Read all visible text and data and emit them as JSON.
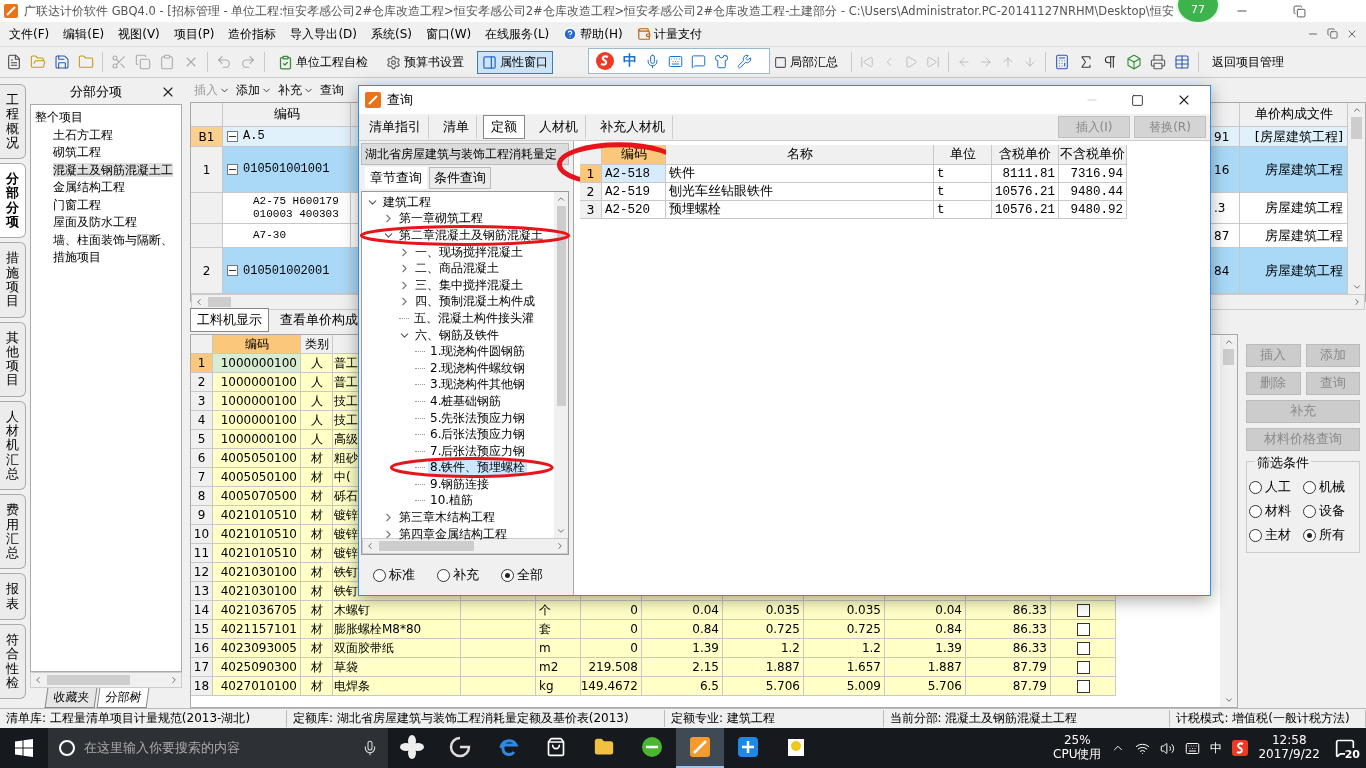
{
  "window": {
    "title": "广联达计价软件 GBQ4.0 - [招标管理 - 单位工程:恒安孝感公司2#仓库改造工程>恒安孝感公司2#仓库改造工程>恒安孝感公司2#仓库改造工程-土建部分 - C:\\Users\\Administrator.PC-20141127NRHM\\Desktop\\恒安",
    "badge": "77"
  },
  "menu": [
    {
      "label": "文件(F)",
      "kind": "text"
    },
    {
      "label": "编辑(E)",
      "kind": "text"
    },
    {
      "label": "视图(V)",
      "kind": "text"
    },
    {
      "label": "项目(P)",
      "kind": "text"
    },
    {
      "label": "造价指标",
      "kind": "text"
    },
    {
      "label": "导入导出(D)",
      "kind": "text"
    },
    {
      "label": "系统(S)",
      "kind": "text"
    },
    {
      "label": "窗口(W)",
      "kind": "text"
    },
    {
      "label": "在线服务(L)",
      "kind": "text"
    },
    {
      "label": "帮助(H)",
      "kind": "help"
    },
    {
      "label": "计量支付",
      "kind": "pay"
    }
  ],
  "toolbar": {
    "check": {
      "label": "单位工程自检"
    },
    "settings": {
      "label": "预算书设置"
    },
    "properties": {
      "label": "属性窗口",
      "selected": true
    },
    "partial_summary": {
      "label": "局部汇总"
    },
    "back": {
      "label": "返回项目管理"
    }
  },
  "ime": {
    "mode": "中"
  },
  "side_tabs": [
    {
      "label": "工程概况",
      "selected": false
    },
    {
      "label": "分部分项",
      "selected": true
    },
    {
      "label": "措施项目",
      "selected": false
    },
    {
      "label": "其他项目",
      "selected": false
    },
    {
      "label": "人材机汇总",
      "selected": false
    },
    {
      "label": "费用汇总",
      "selected": false
    },
    {
      "label": "报表",
      "selected": false
    },
    {
      "label": "符合性检",
      "selected": false
    }
  ],
  "left_panel": {
    "title": "分部分项",
    "tree": {
      "label": "整个项目",
      "selected": false,
      "children": [
        {
          "label": "土石方工程",
          "selected": false
        },
        {
          "label": "砌筑工程",
          "selected": false
        },
        {
          "label": "混凝土及钢筋混凝土工",
          "selected": true
        },
        {
          "label": "金属结构工程",
          "selected": false
        },
        {
          "label": "门窗工程",
          "selected": false
        },
        {
          "label": "屋面及防水工程",
          "selected": false
        },
        {
          "label": "墙、柱面装饰与隔断、",
          "selected": false
        },
        {
          "label": "措施项目",
          "selected": false
        }
      ]
    },
    "tabs": [
      {
        "label": "收藏夹",
        "selected": false
      },
      {
        "label": "分部树",
        "selected": true
      }
    ]
  },
  "grid_toolbar": [
    {
      "label": "插入",
      "disabled": true,
      "dropdown": true
    },
    {
      "label": "添加",
      "disabled": false,
      "dropdown": true
    },
    {
      "label": "补充",
      "disabled": false,
      "dropdown": true
    },
    {
      "label": "查询",
      "disabled": false,
      "dropdown": false
    }
  ],
  "top_grid": {
    "columns": [
      "编码",
      "单价构成文件"
    ],
    "rows": [
      {
        "kind": "division",
        "num": "B1",
        "code": "A.5",
        "expanded": true,
        "column_3": "91",
        "file": "[房屋建筑工程]"
      },
      {
        "kind": "bill",
        "num": "1",
        "code": "010501001001",
        "expanded": true,
        "column_3": "16",
        "file": "房屋建筑工程"
      },
      {
        "kind": "quota",
        "code": "A2-75 H600179 010003 400303",
        "column_3": ".3",
        "file": "房屋建筑工程"
      },
      {
        "kind": "quota",
        "code": "A7-30",
        "column_3": "87",
        "file": "房屋建筑工程"
      },
      {
        "kind": "bill",
        "num": "2",
        "code": "010501002001",
        "expanded": true,
        "column_3": "84",
        "file": "房屋建筑工程"
      }
    ]
  },
  "bottom_tabs": [
    {
      "label": "工料机显示",
      "selected": true
    },
    {
      "label": "查看单价构成",
      "selected": false
    }
  ],
  "bottom_grid": {
    "columns": [
      "编码",
      "类别"
    ],
    "rows": [
      {
        "num": "1",
        "code": "1000000100",
        "type": "人",
        "name": "普工",
        "selected": true
      },
      {
        "num": "2",
        "code": "1000000100",
        "type": "人",
        "name": "普工",
        "selected": false
      },
      {
        "num": "3",
        "code": "1000000100",
        "type": "人",
        "name": "技工",
        "selected": false
      },
      {
        "num": "4",
        "code": "1000000100",
        "type": "人",
        "name": "技工",
        "selected": false
      },
      {
        "num": "5",
        "code": "1000000100",
        "type": "人",
        "name": "高级",
        "selected": false
      },
      {
        "num": "6",
        "code": "4005050100",
        "type": "材",
        "name": "粗砂",
        "selected": false
      },
      {
        "num": "7",
        "code": "4005050100",
        "type": "材",
        "name": "中(",
        "selected": false
      },
      {
        "num": "8",
        "code": "4005070500",
        "type": "材",
        "name": "砾石",
        "selected": false
      },
      {
        "num": "9",
        "code": "4021010510",
        "type": "材",
        "name": "镀锌",
        "selected": false
      },
      {
        "num": "10",
        "code": "4021010510",
        "type": "材",
        "name": "镀锌",
        "selected": false
      },
      {
        "num": "11",
        "code": "4021010510",
        "type": "材",
        "name": "镀锌",
        "selected": false
      },
      {
        "num": "12",
        "code": "4021030100",
        "type": "材",
        "name": "铁钉",
        "selected": false
      },
      {
        "num": "13",
        "code": "4021030100",
        "type": "材",
        "name": "铁钉",
        "selected": false
      },
      {
        "num": "14",
        "code": "4021036705",
        "type": "材",
        "name": "木螺钉",
        "unit": "个",
        "values": [
          "0",
          "0.04",
          "0.035",
          "0.035",
          "0.04",
          "86.33"
        ],
        "checked": false,
        "selected": false
      },
      {
        "num": "15",
        "code": "4021157101",
        "type": "材",
        "name": "膨胀螺栓M8*80",
        "unit": "套",
        "values": [
          "0",
          "0.84",
          "0.725",
          "0.725",
          "0.84",
          "86.33"
        ],
        "checked": false,
        "selected": false
      },
      {
        "num": "16",
        "code": "4023093005",
        "type": "材",
        "name": "双面胶带纸",
        "unit": "m",
        "values": [
          "0",
          "1.39",
          "1.2",
          "1.2",
          "1.39",
          "86.33"
        ],
        "checked": false,
        "selected": false
      },
      {
        "num": "17",
        "code": "4025090300",
        "type": "材",
        "name": "草袋",
        "unit": "m2",
        "values": [
          "219.508",
          "2.15",
          "1.887",
          "1.657",
          "1.887",
          "87.79"
        ],
        "checked": false,
        "selected": false
      },
      {
        "num": "18",
        "code": "4027010100",
        "type": "材",
        "name": "电焊条",
        "unit": "kg",
        "values": [
          "149.4672",
          "6.5",
          "5.706",
          "5.009",
          "5.706",
          "87.79"
        ],
        "checked": false,
        "selected": false
      }
    ]
  },
  "right_panel": {
    "buttons": [
      {
        "label": "插入",
        "disabled": true,
        "wide": false
      },
      {
        "label": "添加",
        "disabled": true,
        "wide": false
      },
      {
        "label": "删除",
        "disabled": true,
        "wide": false
      },
      {
        "label": "查询",
        "disabled": true,
        "wide": false
      },
      {
        "label": "补充",
        "disabled": true,
        "wide": true
      },
      {
        "label": "材料价格查询",
        "disabled": true,
        "wide": true
      }
    ],
    "filter": {
      "title": "筛选条件",
      "options": [
        {
          "label": "人工",
          "selected": false
        },
        {
          "label": "机械",
          "selected": false
        },
        {
          "label": "材料",
          "selected": false
        },
        {
          "label": "设备",
          "selected": false
        },
        {
          "label": "主材",
          "selected": false
        },
        {
          "label": "所有",
          "selected": true
        }
      ]
    }
  },
  "dialog": {
    "title": "查询",
    "tabs": [
      {
        "label": "清单指引",
        "selected": false
      },
      {
        "label": "清单",
        "selected": false
      },
      {
        "label": "定额",
        "selected": true
      },
      {
        "label": "人材机",
        "selected": false
      },
      {
        "label": "补充人材机",
        "selected": false
      }
    ],
    "buttons": [
      {
        "label": "插入(I)",
        "disabled": true
      },
      {
        "label": "替换(R)",
        "disabled": true
      }
    ],
    "library": "湖北省房屋建筑与装饰工程消耗量定",
    "subtabs": [
      {
        "label": "章节查询",
        "selected": true
      },
      {
        "label": "条件查询",
        "selected": false
      }
    ],
    "tree": [
      {
        "label": "建筑工程",
        "expanded": true,
        "selected": false,
        "children": [
          {
            "label": "第一章砌筑工程",
            "expanded": false,
            "selected": false
          },
          {
            "label": "第二章混凝土及钢筋混凝土",
            "expanded": true,
            "selected": false,
            "circled": true,
            "children": [
              {
                "label": "一、现场搅拌混凝土",
                "expanded": false,
                "selected": false
              },
              {
                "label": "二、商品混凝土",
                "expanded": false,
                "selected": false
              },
              {
                "label": "三、集中搅拌混凝土",
                "expanded": false,
                "selected": false
              },
              {
                "label": "四、预制混凝土构件成",
                "expanded": false,
                "selected": false
              },
              {
                "label": "五、混凝土构件接头灌",
                "selected": false
              },
              {
                "label": "六、钢筋及铁件",
                "expanded": true,
                "selected": false,
                "children": [
                  {
                    "label": "1.现浇构件圆钢筋",
                    "selected": false
                  },
                  {
                    "label": "2.现浇构件螺纹钢",
                    "selected": false
                  },
                  {
                    "label": "3.现浇构件其他钢",
                    "selected": false
                  },
                  {
                    "label": "4.桩基础钢筋",
                    "selected": false
                  },
                  {
                    "label": "5.先张法预应力钢",
                    "selected": false
                  },
                  {
                    "label": "6.后张法预应力钢",
                    "selected": false
                  },
                  {
                    "label": "7.后张法预应力钢",
                    "selected": false
                  },
                  {
                    "label": "8.铁件、预埋螺栓",
                    "selected": true,
                    "circled": true
                  },
                  {
                    "label": "9.钢筋连接",
                    "selected": false
                  },
                  {
                    "label": "10.植筋",
                    "selected": false
                  }
                ]
              }
            ]
          },
          {
            "label": "第三章木结构工程",
            "expanded": false,
            "selected": false
          },
          {
            "label": "第四章金属结构工程",
            "expanded": false,
            "selected": false
          }
        ]
      }
    ],
    "scope": [
      {
        "label": "标准",
        "selected": false
      },
      {
        "label": "补充",
        "selected": false
      },
      {
        "label": "全部",
        "selected": true
      }
    ],
    "table": {
      "columns": [
        {
          "label": "编码",
          "circled": true
        },
        {
          "label": "名称",
          "circled": false
        },
        {
          "label": "单位",
          "circled": false
        },
        {
          "label": "含税单价",
          "circled": false
        },
        {
          "label": "不含税单价",
          "circled": false
        }
      ],
      "rows": [
        {
          "num": "1",
          "cells": [
            "A2-518",
            "铁件",
            "t",
            "8111.81",
            "7316.94"
          ],
          "selected": true
        },
        {
          "num": "2",
          "cells": [
            "A2-519",
            "刨光车丝钻眼铁件",
            "t",
            "10576.21",
            "9480.44"
          ],
          "selected": false
        },
        {
          "num": "3",
          "cells": [
            "A2-520",
            "预埋螺栓",
            "t",
            "10576.21",
            "9480.92"
          ],
          "selected": false
        }
      ]
    }
  },
  "status_bar": [
    "清单库: 工程量清单项目计量规范(2013-湖北)",
    "定额库: 湖北省房屋建筑与装饰工程消耗量定额及基价表(2013)",
    "定额专业: 建筑工程",
    "当前分部: 混凝土及钢筋混凝土工程",
    "计税模式: 增值税(一般计税方法)"
  ],
  "taskbar": {
    "search": {
      "placeholder": "在这里输入你要搜索的内容"
    },
    "cpu": "25%",
    "cpu_label": "CPU使用",
    "ime": "中",
    "time": "12:58",
    "date": "2017/9/22",
    "notifications": "20"
  }
}
